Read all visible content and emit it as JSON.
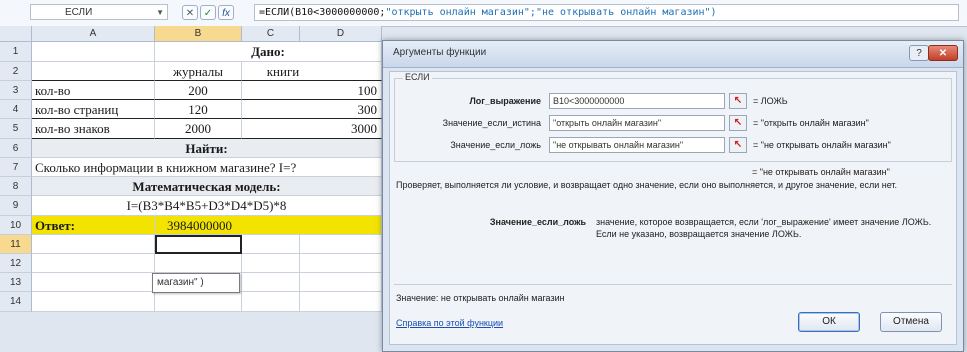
{
  "formula_bar": {
    "name_box": "ЕСЛИ",
    "cancel_glyph": "✕",
    "enter_glyph": "✓",
    "fx_glyph": "fx",
    "formula_prefix": "=ЕСЛИ(B10<3000000000;",
    "formula_args": "\"открыть онлайн магазин\";\"не открывать онлайн магазин\")"
  },
  "grid": {
    "columns": [
      "A",
      "B",
      "C",
      "D"
    ],
    "row_numbers": [
      "1",
      "2",
      "3",
      "4",
      "5",
      "6",
      "7",
      "8",
      "9",
      "10",
      "11",
      "12",
      "13",
      "14"
    ],
    "cells": {
      "r1_given": "Дано:",
      "r2_journals": "журналы",
      "r2_books": "книги",
      "r3_label": "кол-во",
      "r3_b": "200",
      "r3_c": "100",
      "r4_label": "кол-во страниц",
      "r4_b": "120",
      "r4_c": "300",
      "r5_label": "кол-во знаков",
      "r5_b": "2000",
      "r5_c": "3000",
      "r6_find": "Найти:",
      "r7_question": "Сколько информации в книжном магазине?  I=?",
      "r8_model": "Математическая модель:",
      "r9_formula": "I=(B3*B4*B5+D3*D4*D5)*8",
      "r10_label": "Ответ:",
      "r10_value": "3984000000",
      "r11_tip": "магазин\" )"
    }
  },
  "dialog": {
    "title": "Аргументы функции",
    "help_glyph": "?",
    "close_glyph": "✕",
    "group_name": "ЕСЛИ",
    "args": [
      {
        "label": "Лог_выражение",
        "value": "B10<3000000000",
        "result": "= ЛОЖЬ",
        "bold": true
      },
      {
        "label": "Значение_если_истина",
        "value": "\"открыть онлайн магазин\"",
        "result": "= \"открыть онлайн магазин\"",
        "bold": false
      },
      {
        "label": "Значение_если_ложь",
        "value": "\"не открывать онлайн магазин\"",
        "result": "= \"не открывать онлайн магазин\"",
        "bold": false
      }
    ],
    "overall_result": "= \"не открывать онлайн магазин\"",
    "description": "Проверяет, выполняется ли условие, и возвращает одно значение, если оно выполняется, и другое значение, если нет.",
    "param_name": "Значение_если_ложь",
    "param_desc": "значение, которое возвращается, если 'лог_выражение' имеет значение ЛОЖЬ. Если не указано, возвращается значение ЛОЖЬ.",
    "value_line": "Значение:  не открывать онлайн магазин",
    "help_link": "Справка по этой функции",
    "ok_label": "ОК",
    "cancel_label": "Отмена"
  },
  "colors": {
    "answer_highlight": "#f2e400",
    "selected_header": "#f7d98f",
    "close_button": "#c33f28"
  }
}
